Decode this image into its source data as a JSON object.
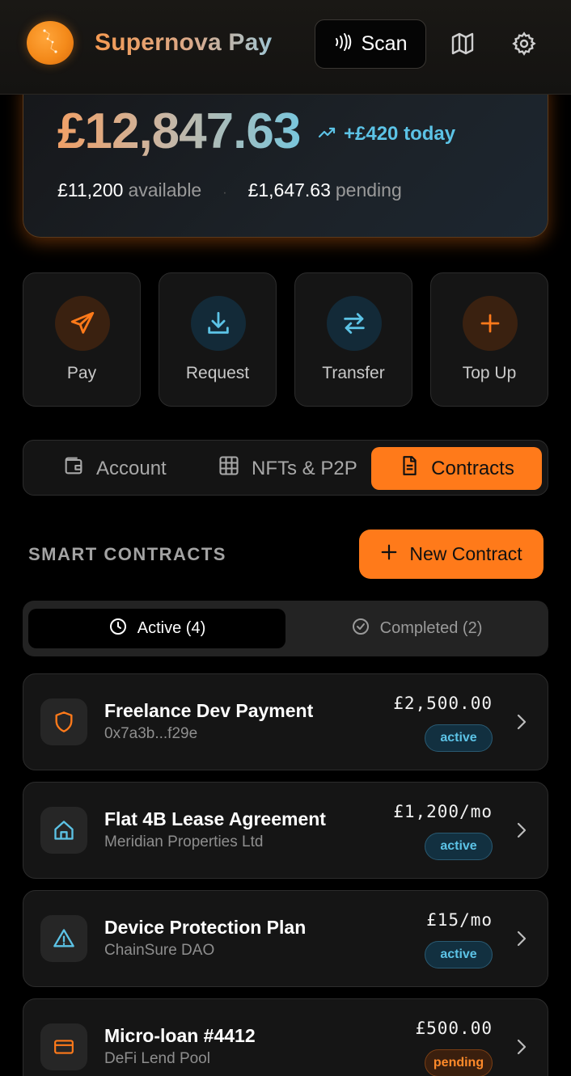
{
  "header": {
    "app_title": "Supernova Pay",
    "scan_label": "Scan",
    "icons": [
      "logo-icon",
      "contactless-icon",
      "map-icon",
      "gear-icon"
    ]
  },
  "balance": {
    "total": "£12,847.63",
    "delta": "+£420 today",
    "available_value": "£11,200",
    "available_label": "available",
    "separator": "·",
    "pending_value": "£1,647.63",
    "pending_label": "pending"
  },
  "actions": [
    {
      "label": "Pay",
      "icon": "send-icon"
    },
    {
      "label": "Request",
      "icon": "download-icon"
    },
    {
      "label": "Transfer",
      "icon": "transfer-icon"
    },
    {
      "label": "Top Up",
      "icon": "plus-icon"
    }
  ],
  "tabs": [
    {
      "label": "Account",
      "icon": "wallet-icon"
    },
    {
      "label": "NFTs & P2P",
      "icon": "grid-icon"
    },
    {
      "label": "Contracts",
      "icon": "document-icon",
      "active": true
    }
  ],
  "contracts_section": {
    "title": "SMART CONTRACTS",
    "new_button": "New Contract",
    "filter_active": "Active (4)",
    "filter_completed": "Completed (2)"
  },
  "contracts": [
    {
      "title": "Freelance Dev Payment",
      "subtitle": "0x7a3b...f29e",
      "amount": "£2,500.00",
      "status": "active",
      "icon": "shield-icon"
    },
    {
      "title": "Flat 4B Lease Agreement",
      "subtitle": "Meridian Properties Ltd",
      "amount": "£1,200/mo",
      "status": "active",
      "icon": "home-icon"
    },
    {
      "title": "Device Protection Plan",
      "subtitle": "ChainSure DAO",
      "amount": "£15/mo",
      "status": "active",
      "icon": "warning-icon"
    },
    {
      "title": "Micro-loan #4412",
      "subtitle": "DeFi Lend Pool",
      "amount": "£500.00",
      "status": "pending",
      "icon": "card-icon"
    }
  ],
  "colors": {
    "accent": "#ff7a1a",
    "info": "#5cc3e6",
    "background": "#000000",
    "surface": "#151515"
  }
}
